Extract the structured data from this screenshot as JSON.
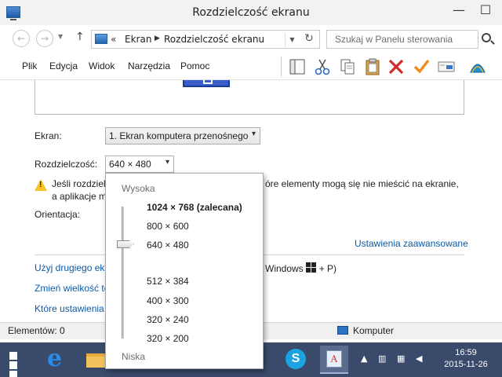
{
  "window": {
    "title": "Rozdzielczość ekranu",
    "minimize_glyph": "—",
    "maximize_glyph": "☐"
  },
  "address": {
    "back_glyph": "←",
    "forward_glyph": "→",
    "up_glyph": "↑",
    "chevrons": "«",
    "segment_1": "Ekran",
    "separator": "▶",
    "segment_2": "Rozdzielczość ekranu",
    "dropdown_glyph": "▼",
    "refresh_glyph": "↻",
    "search_placeholder": "Szukaj w Panelu sterowania"
  },
  "menu": {
    "items": [
      "Plik",
      "Edycja",
      "Widok",
      "Narzędzia",
      "Pomoc"
    ]
  },
  "toolbar_icons": [
    "properties-pane-icon",
    "cut-icon",
    "copy-icon",
    "paste-icon",
    "delete-icon",
    "check-icon",
    "display-icon",
    "shell-icon"
  ],
  "settings": {
    "screen_label": "Ekran:",
    "screen_value": "1. Ekran komputera przenośnego",
    "resolution_label": "Rozdzielczość:",
    "resolution_value": "640 × 480",
    "warning_line1_start": "Jeśli rozdzielc",
    "warning_line1_end": "óre elementy mogą się nie mieścić na ekranie,",
    "warning_line2": "a aplikacje m",
    "orientation_label": "Orientacja:",
    "advanced_link": "Ustawienia zaawansowane",
    "link_1": "Użyj drugiego ekr",
    "link_1_tail_a": "Windows",
    "link_1_tail_b": "+ P)",
    "link_2": "Zmień wielkość te",
    "link_3": "Które ustawienia e",
    "arrow_glyph": "▾"
  },
  "resolution_popup": {
    "high_label": "Wysoka",
    "low_label": "Niska",
    "options": [
      "1024 × 768 (zalecana)",
      "800 × 600",
      "640 × 480",
      "512 × 384",
      "400 × 300",
      "320 × 240",
      "320 × 200"
    ],
    "recommended_index": 0,
    "selected_index": 2
  },
  "status": {
    "items_count": "Elementów: 0",
    "computer_label": "Komputer"
  },
  "taskbar": {
    "ie_glyph": "e",
    "skype_glyph": "S",
    "cp_glyph": "A",
    "tray_up": "▲",
    "tray_network": "▥",
    "tray_flag": "▦",
    "tray_volume": "◀",
    "time": "16:59",
    "date": "2015-11-26"
  },
  "colors": {
    "accent_link": "#0b5aa8",
    "taskbar_bg": "#3a4a6a",
    "warning": "#f7c325"
  }
}
